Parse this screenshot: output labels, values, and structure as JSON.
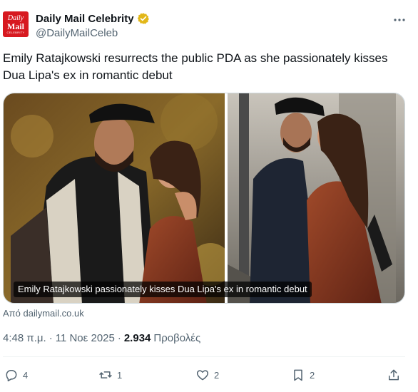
{
  "account": {
    "logo_line1": "Daily",
    "logo_line2": "Mail",
    "logo_line3": "CELEBRITY",
    "display_name": "Daily Mail Celebrity",
    "handle": "@DailyMailCeleb",
    "verified_color": "#e2b719"
  },
  "tweet": {
    "text": "Emily Ratajkowski resurrects the public PDA as she passionately kisses Dua Lipa's ex in romantic debut",
    "media_caption": "Emily Ratajkowski passionately kisses Dua Lipa's ex in romantic debut",
    "source": "Από dailymail.co.uk",
    "time": "4:48 π.μ.",
    "separator": "·",
    "date": "11 Νοε 2025",
    "views_count": "2.934",
    "views_label": "Προβολές"
  },
  "actions": {
    "replies": "4",
    "reposts": "1",
    "likes": "2",
    "bookmarks": "2"
  },
  "icons": {
    "more": "more-icon",
    "reply": "reply-icon",
    "repost": "repost-icon",
    "like": "heart-icon",
    "bookmark": "bookmark-icon",
    "share": "share-icon"
  },
  "colors": {
    "brand_red": "#d71920",
    "text_primary": "#0f1419",
    "text_secondary": "#536471"
  }
}
